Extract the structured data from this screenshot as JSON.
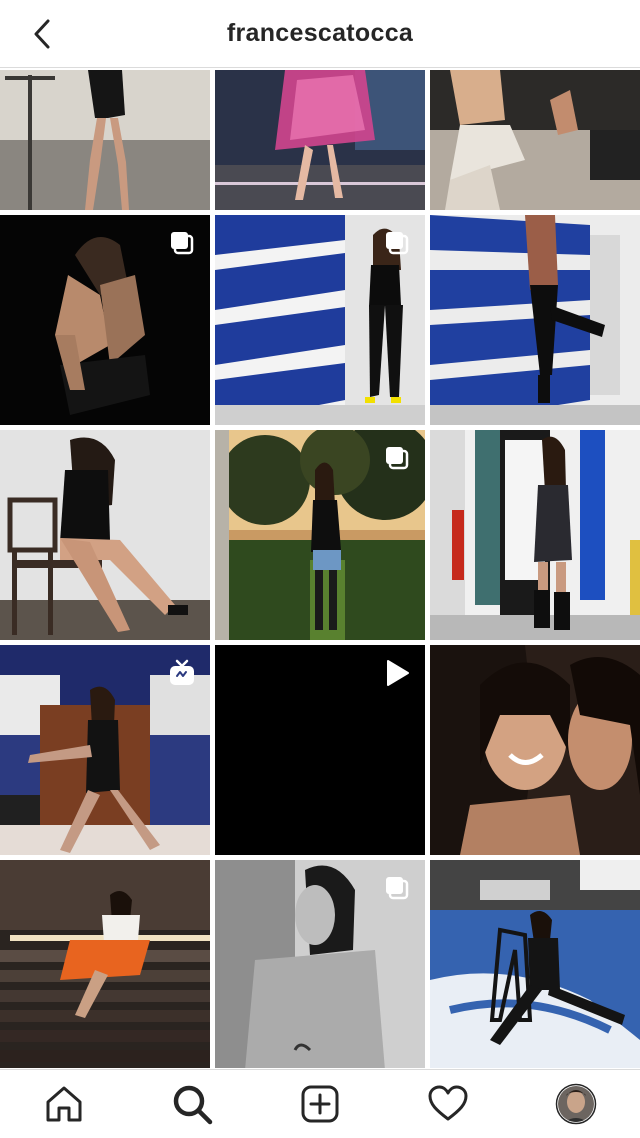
{
  "header": {
    "username": "francescatocca",
    "back_icon": "chevron-left-icon"
  },
  "grid": {
    "posts": [
      {
        "id": 1,
        "scene": "dance-studio-legs",
        "badge": null
      },
      {
        "id": 2,
        "scene": "pink-tulle-skirt-stage",
        "badge": null
      },
      {
        "id": 3,
        "scene": "posing-in-office",
        "badge": null
      },
      {
        "id": 4,
        "scene": "couple-embrace-dark-stage",
        "badge": "multiple-photos-icon"
      },
      {
        "id": 5,
        "scene": "blue-stripe-wall-black-outfit",
        "badge": "multiple-photos-icon"
      },
      {
        "id": 6,
        "scene": "blue-stripe-wall-leg-raise",
        "badge": null
      },
      {
        "id": 7,
        "scene": "woman-on-chair-heels",
        "badge": null
      },
      {
        "id": 8,
        "scene": "garden-sunset-portrait",
        "badge": "multiple-photos-icon"
      },
      {
        "id": 9,
        "scene": "hallway-dress-boots",
        "badge": null
      },
      {
        "id": 10,
        "scene": "tv-studio-dance",
        "badge": "igtv-icon"
      },
      {
        "id": 11,
        "scene": "black-video-frame",
        "badge": "video-play-icon"
      },
      {
        "id": 12,
        "scene": "two-friends-selfie",
        "badge": null
      },
      {
        "id": 13,
        "scene": "stairs-orange-skirt",
        "badge": null
      },
      {
        "id": 14,
        "scene": "black-white-back-portrait",
        "badge": "multiple-photos-icon"
      },
      {
        "id": 15,
        "scene": "chair-split-blue-floor",
        "badge": null
      }
    ]
  },
  "bottom_nav": {
    "items": [
      {
        "name": "home",
        "icon": "home-icon"
      },
      {
        "name": "search",
        "icon": "search-icon"
      },
      {
        "name": "new-post",
        "icon": "add-post-icon"
      },
      {
        "name": "activity",
        "icon": "heart-icon"
      },
      {
        "name": "profile",
        "icon": "profile-avatar-icon"
      }
    ]
  },
  "colors": {
    "text": "#262626",
    "divider": "#dbdbdb",
    "background": "#ffffff"
  }
}
